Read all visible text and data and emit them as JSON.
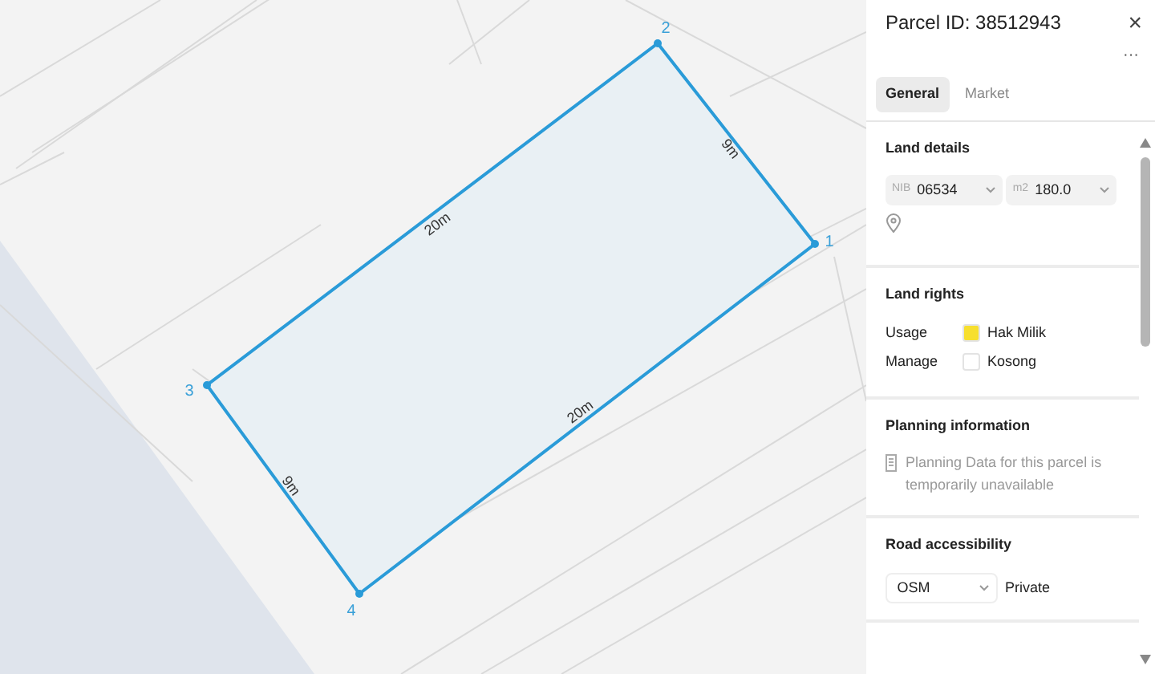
{
  "map": {
    "vertices": [
      {
        "label": "1"
      },
      {
        "label": "2"
      },
      {
        "label": "3"
      },
      {
        "label": "4"
      }
    ],
    "edges": [
      {
        "label": "9m"
      },
      {
        "label": "20m"
      },
      {
        "label": "9m"
      },
      {
        "label": "20m"
      }
    ]
  },
  "panel": {
    "title": "Parcel ID: 38512943",
    "close": "×",
    "more": "···",
    "tabs": [
      {
        "label": "General",
        "selected": true
      },
      {
        "label": "Market",
        "selected": false
      }
    ],
    "land_details": {
      "heading": "Land details",
      "fields": [
        {
          "prefix": "NIB",
          "value": "06534"
        },
        {
          "prefix": "m2",
          "value": "180.0"
        }
      ]
    },
    "land_rights": {
      "heading": "Land rights",
      "rows": [
        {
          "label": "Usage",
          "value": "Hak Milik",
          "color": "#f7df2e"
        },
        {
          "label": "Manage",
          "value": "Kosong",
          "color": "#ffffff"
        }
      ]
    },
    "planning": {
      "heading": "Planning information",
      "message": "Planning Data for this parcel is temporarily unavailable"
    },
    "road": {
      "heading": "Road accessibility",
      "select": "OSM",
      "value": "Private"
    }
  }
}
